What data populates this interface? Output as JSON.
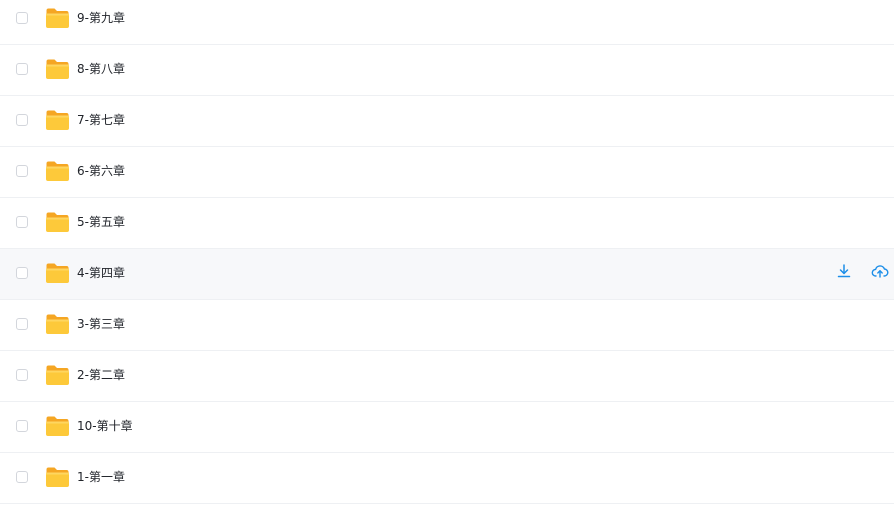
{
  "files": [
    {
      "name": "9-第九章",
      "hovered": false
    },
    {
      "name": "8-第八章",
      "hovered": false
    },
    {
      "name": "7-第七章",
      "hovered": false
    },
    {
      "name": "6-第六章",
      "hovered": false
    },
    {
      "name": "5-第五章",
      "hovered": false
    },
    {
      "name": "4-第四章",
      "hovered": true
    },
    {
      "name": "3-第三章",
      "hovered": false
    },
    {
      "name": "2-第二章",
      "hovered": false
    },
    {
      "name": "10-第十章",
      "hovered": false
    },
    {
      "name": "1-第一章",
      "hovered": false
    }
  ],
  "icons": {
    "folder": "folder-icon",
    "download": "download-icon",
    "save": "cloud-save-icon"
  },
  "colors": {
    "folder": "#fbc02d",
    "accent": "#1c8ee8",
    "hover_bg": "#f7f8fa"
  }
}
